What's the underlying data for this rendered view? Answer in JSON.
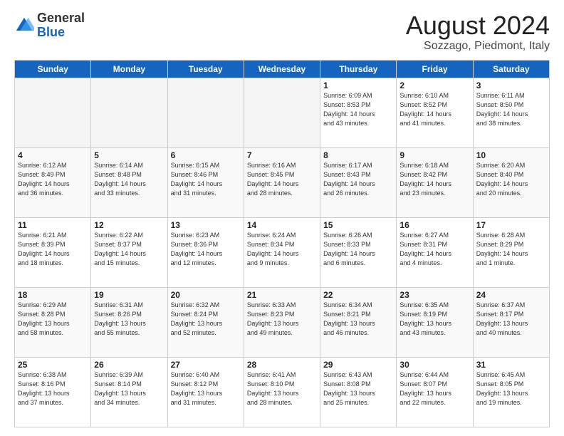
{
  "header": {
    "logo_general": "General",
    "logo_blue": "Blue",
    "main_title": "August 2024",
    "subtitle": "Sozzago, Piedmont, Italy"
  },
  "calendar": {
    "days_of_week": [
      "Sunday",
      "Monday",
      "Tuesday",
      "Wednesday",
      "Thursday",
      "Friday",
      "Saturday"
    ],
    "weeks": [
      [
        {
          "day": "",
          "info": ""
        },
        {
          "day": "",
          "info": ""
        },
        {
          "day": "",
          "info": ""
        },
        {
          "day": "",
          "info": ""
        },
        {
          "day": "1",
          "info": "Sunrise: 6:09 AM\nSunset: 8:53 PM\nDaylight: 14 hours\nand 43 minutes."
        },
        {
          "day": "2",
          "info": "Sunrise: 6:10 AM\nSunset: 8:52 PM\nDaylight: 14 hours\nand 41 minutes."
        },
        {
          "day": "3",
          "info": "Sunrise: 6:11 AM\nSunset: 8:50 PM\nDaylight: 14 hours\nand 38 minutes."
        }
      ],
      [
        {
          "day": "4",
          "info": "Sunrise: 6:12 AM\nSunset: 8:49 PM\nDaylight: 14 hours\nand 36 minutes."
        },
        {
          "day": "5",
          "info": "Sunrise: 6:14 AM\nSunset: 8:48 PM\nDaylight: 14 hours\nand 33 minutes."
        },
        {
          "day": "6",
          "info": "Sunrise: 6:15 AM\nSunset: 8:46 PM\nDaylight: 14 hours\nand 31 minutes."
        },
        {
          "day": "7",
          "info": "Sunrise: 6:16 AM\nSunset: 8:45 PM\nDaylight: 14 hours\nand 28 minutes."
        },
        {
          "day": "8",
          "info": "Sunrise: 6:17 AM\nSunset: 8:43 PM\nDaylight: 14 hours\nand 26 minutes."
        },
        {
          "day": "9",
          "info": "Sunrise: 6:18 AM\nSunset: 8:42 PM\nDaylight: 14 hours\nand 23 minutes."
        },
        {
          "day": "10",
          "info": "Sunrise: 6:20 AM\nSunset: 8:40 PM\nDaylight: 14 hours\nand 20 minutes."
        }
      ],
      [
        {
          "day": "11",
          "info": "Sunrise: 6:21 AM\nSunset: 8:39 PM\nDaylight: 14 hours\nand 18 minutes."
        },
        {
          "day": "12",
          "info": "Sunrise: 6:22 AM\nSunset: 8:37 PM\nDaylight: 14 hours\nand 15 minutes."
        },
        {
          "day": "13",
          "info": "Sunrise: 6:23 AM\nSunset: 8:36 PM\nDaylight: 14 hours\nand 12 minutes."
        },
        {
          "day": "14",
          "info": "Sunrise: 6:24 AM\nSunset: 8:34 PM\nDaylight: 14 hours\nand 9 minutes."
        },
        {
          "day": "15",
          "info": "Sunrise: 6:26 AM\nSunset: 8:33 PM\nDaylight: 14 hours\nand 6 minutes."
        },
        {
          "day": "16",
          "info": "Sunrise: 6:27 AM\nSunset: 8:31 PM\nDaylight: 14 hours\nand 4 minutes."
        },
        {
          "day": "17",
          "info": "Sunrise: 6:28 AM\nSunset: 8:29 PM\nDaylight: 14 hours\nand 1 minute."
        }
      ],
      [
        {
          "day": "18",
          "info": "Sunrise: 6:29 AM\nSunset: 8:28 PM\nDaylight: 13 hours\nand 58 minutes."
        },
        {
          "day": "19",
          "info": "Sunrise: 6:31 AM\nSunset: 8:26 PM\nDaylight: 13 hours\nand 55 minutes."
        },
        {
          "day": "20",
          "info": "Sunrise: 6:32 AM\nSunset: 8:24 PM\nDaylight: 13 hours\nand 52 minutes."
        },
        {
          "day": "21",
          "info": "Sunrise: 6:33 AM\nSunset: 8:23 PM\nDaylight: 13 hours\nand 49 minutes."
        },
        {
          "day": "22",
          "info": "Sunrise: 6:34 AM\nSunset: 8:21 PM\nDaylight: 13 hours\nand 46 minutes."
        },
        {
          "day": "23",
          "info": "Sunrise: 6:35 AM\nSunset: 8:19 PM\nDaylight: 13 hours\nand 43 minutes."
        },
        {
          "day": "24",
          "info": "Sunrise: 6:37 AM\nSunset: 8:17 PM\nDaylight: 13 hours\nand 40 minutes."
        }
      ],
      [
        {
          "day": "25",
          "info": "Sunrise: 6:38 AM\nSunset: 8:16 PM\nDaylight: 13 hours\nand 37 minutes."
        },
        {
          "day": "26",
          "info": "Sunrise: 6:39 AM\nSunset: 8:14 PM\nDaylight: 13 hours\nand 34 minutes."
        },
        {
          "day": "27",
          "info": "Sunrise: 6:40 AM\nSunset: 8:12 PM\nDaylight: 13 hours\nand 31 minutes."
        },
        {
          "day": "28",
          "info": "Sunrise: 6:41 AM\nSunset: 8:10 PM\nDaylight: 13 hours\nand 28 minutes."
        },
        {
          "day": "29",
          "info": "Sunrise: 6:43 AM\nSunset: 8:08 PM\nDaylight: 13 hours\nand 25 minutes."
        },
        {
          "day": "30",
          "info": "Sunrise: 6:44 AM\nSunset: 8:07 PM\nDaylight: 13 hours\nand 22 minutes."
        },
        {
          "day": "31",
          "info": "Sunrise: 6:45 AM\nSunset: 8:05 PM\nDaylight: 13 hours\nand 19 minutes."
        }
      ]
    ]
  }
}
